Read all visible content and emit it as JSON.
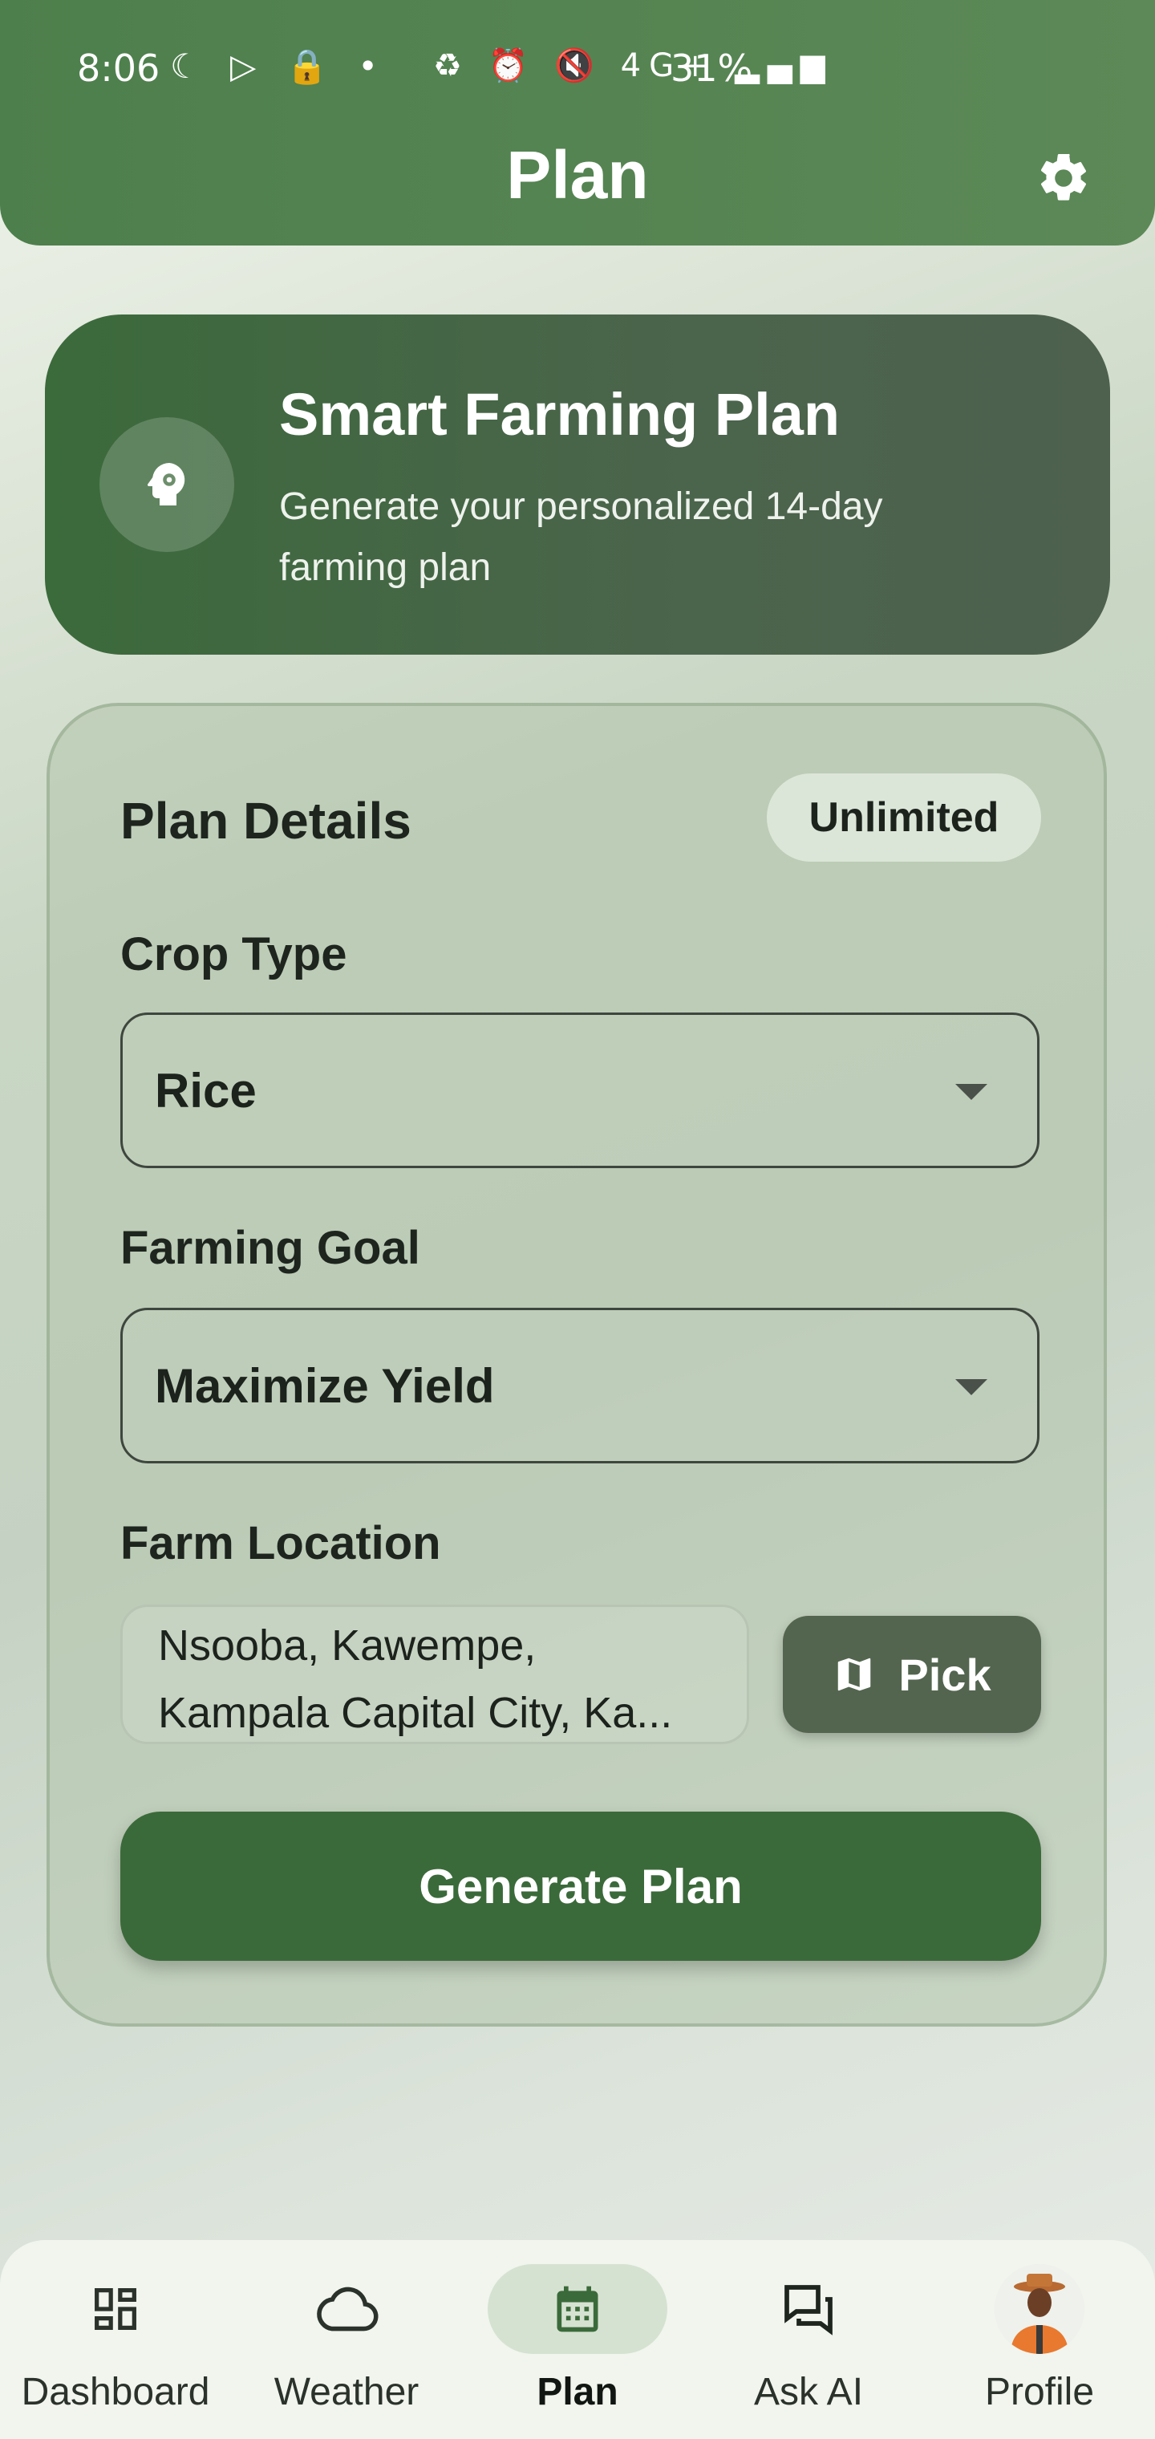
{
  "status_bar": {
    "time": "8:06",
    "left_icons": "☾ ▷ 🔒 •",
    "right_icons": "♻ ⏰ 🔇 4G+ ▂▄▆",
    "battery": "31%"
  },
  "app_bar": {
    "title": "Plan",
    "settings_icon": "gear-icon"
  },
  "hero": {
    "icon": "brain-gear-icon",
    "title": "Smart Farming Plan",
    "subtitle": "Generate your personalized 14-day farming plan"
  },
  "details": {
    "title": "Plan Details",
    "badge": "Unlimited",
    "crop_label": "Crop Type",
    "crop_value": "Rice",
    "goal_label": "Farming Goal",
    "goal_value": "Maximize Yield",
    "location_label": "Farm Location",
    "location_line1": "Nsooba, Kawempe,",
    "location_line2": "Kampala Capital City, Ka...",
    "pick_label": "Pick",
    "generate_label": "Generate Plan"
  },
  "bottom_nav": {
    "items": [
      {
        "label": "Dashboard",
        "icon": "dashboard-icon"
      },
      {
        "label": "Weather",
        "icon": "cloud-icon"
      },
      {
        "label": "Plan",
        "icon": "calendar-icon",
        "active": true
      },
      {
        "label": "Ask AI",
        "icon": "chat-icon"
      },
      {
        "label": "Profile",
        "icon": "avatar"
      }
    ]
  },
  "colors": {
    "primary": "#3b6a3a",
    "app_bar": "#4d7f4c",
    "pick_button": "#53654f"
  }
}
